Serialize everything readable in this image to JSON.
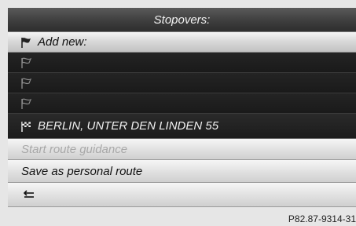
{
  "screen": {
    "title": "Stopovers:",
    "rows": [
      {
        "label": "Add new:",
        "icon": "flag-icon"
      },
      {
        "label": "",
        "icon": "flag-icon"
      },
      {
        "label": "",
        "icon": "flag-icon"
      },
      {
        "label": "",
        "icon": "flag-icon"
      },
      {
        "label": "BERLIN, UNTER DEN LINDEN 55",
        "icon": "checkered-flag-icon"
      },
      {
        "label": "Start route guidance",
        "disabled": true
      },
      {
        "label": "Save as personal route"
      },
      {
        "label": "",
        "icon": "back-arrow-icon"
      }
    ]
  },
  "figure_ref": "P82.87-9314-31"
}
